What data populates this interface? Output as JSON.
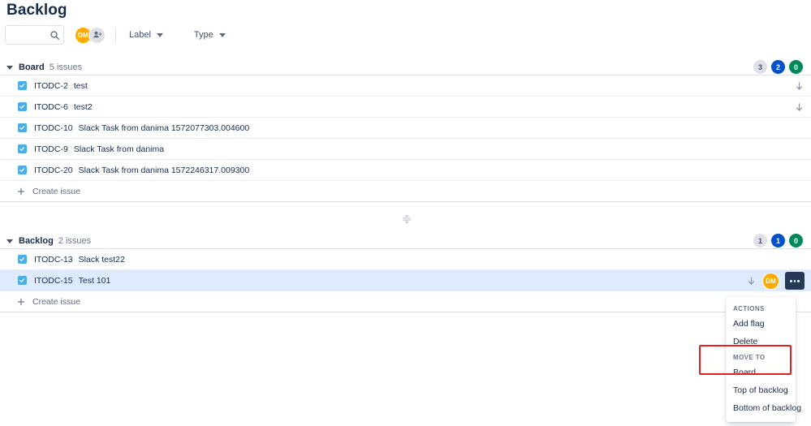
{
  "page": {
    "title": "Backlog"
  },
  "toolbar": {
    "search": {
      "value": "",
      "placeholder": ""
    },
    "avatars": [
      {
        "initials": "DM",
        "color": "#ffab00",
        "name": "avatar-dm"
      }
    ],
    "add_people_label": "",
    "filters": [
      {
        "label": "Label"
      },
      {
        "label": "Type"
      }
    ]
  },
  "sections": [
    {
      "name": "Board",
      "count_label": "5 issues",
      "badges": [
        {
          "value": "3",
          "style": "gray"
        },
        {
          "value": "2",
          "style": "blue"
        },
        {
          "value": "0",
          "style": "green"
        }
      ],
      "issues": [
        {
          "key": "ITODC-2",
          "summary": "test",
          "priority": "arrow-down",
          "assignee": "",
          "selected": false
        },
        {
          "key": "ITODC-6",
          "summary": "test2",
          "priority": "arrow-down",
          "assignee": "",
          "selected": false
        },
        {
          "key": "ITODC-10",
          "summary": "Slack Task from danima 1572077303.004600",
          "priority": "",
          "assignee": "",
          "selected": false
        },
        {
          "key": "ITODC-9",
          "summary": "Slack Task from danima",
          "priority": "",
          "assignee": "",
          "selected": false
        },
        {
          "key": "ITODC-20",
          "summary": "Slack Task from danima 1572246317.009300",
          "priority": "",
          "assignee": "",
          "selected": false
        }
      ],
      "create_issue_label": "Create issue"
    },
    {
      "name": "Backlog",
      "count_label": "2 issues",
      "badges": [
        {
          "value": "1",
          "style": "gray"
        },
        {
          "value": "1",
          "style": "blue"
        },
        {
          "value": "0",
          "style": "green"
        }
      ],
      "issues": [
        {
          "key": "ITODC-13",
          "summary": "Slack test22",
          "priority": "",
          "assignee": "",
          "selected": false
        },
        {
          "key": "ITODC-15",
          "summary": "Test 101",
          "priority": "arrow-down",
          "assignee": "DM",
          "selected": true
        }
      ],
      "create_issue_label": "Create issue"
    }
  ],
  "context_menu": {
    "groups": [
      {
        "heading": "ACTIONS",
        "items": [
          {
            "label": "Add flag"
          },
          {
            "label": "Delete"
          }
        ]
      },
      {
        "heading": "MOVE TO",
        "items": [
          {
            "label": "Board"
          },
          {
            "label": "Top of backlog"
          },
          {
            "label": "Bottom of backlog"
          }
        ]
      }
    ]
  },
  "annotation": {
    "color": "#e02020"
  }
}
